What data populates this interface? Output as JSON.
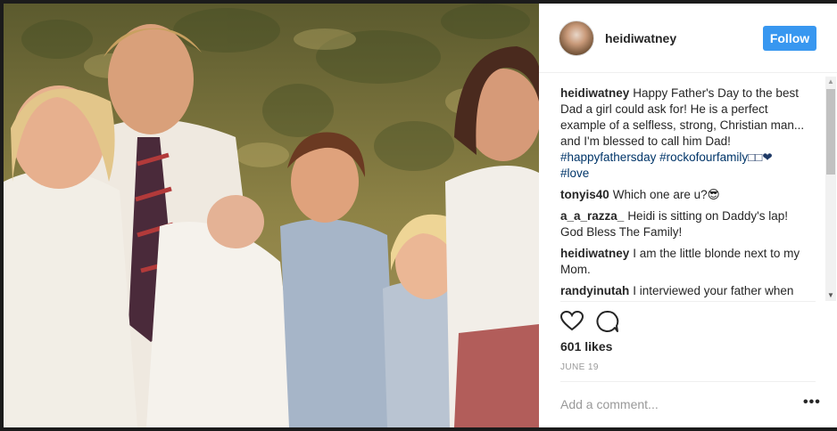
{
  "post": {
    "username": "heidiwatney",
    "follow_label": "Follow",
    "likes": "601 likes",
    "date": "JUNE 19",
    "add_comment_placeholder": "Add a comment...",
    "more_label": "•••"
  },
  "caption": {
    "user": "heidiwatney",
    "text": "Happy Father's Day to the best Dad a girl could ask for! He is a perfect example of a selfless, strong, Christian man... and I'm blessed to call him Dad!",
    "hashtags": "#happyfathersday #rockofourfamily",
    "emojis": "□□❤",
    "hashtag2": "#love"
  },
  "comments": [
    {
      "user": "tonyis40",
      "text": "Which one are u?😎"
    },
    {
      "user": "a_a_razza_",
      "text": "Heidi is sitting on Daddy's lap! God Bless The Family!"
    },
    {
      "user": "heidiwatney",
      "text": "I am the little blonde next to my Mom."
    },
    {
      "user": "randyinutah",
      "text": "I interviewed your father when"
    }
  ],
  "icons": {
    "like": "heart-icon",
    "comment": "comment-bubble-icon",
    "more": "more-options-icon"
  },
  "colors": {
    "follow_bg": "#3897f0",
    "hashtag": "#003569",
    "text": "#262626",
    "muted": "#999999"
  }
}
